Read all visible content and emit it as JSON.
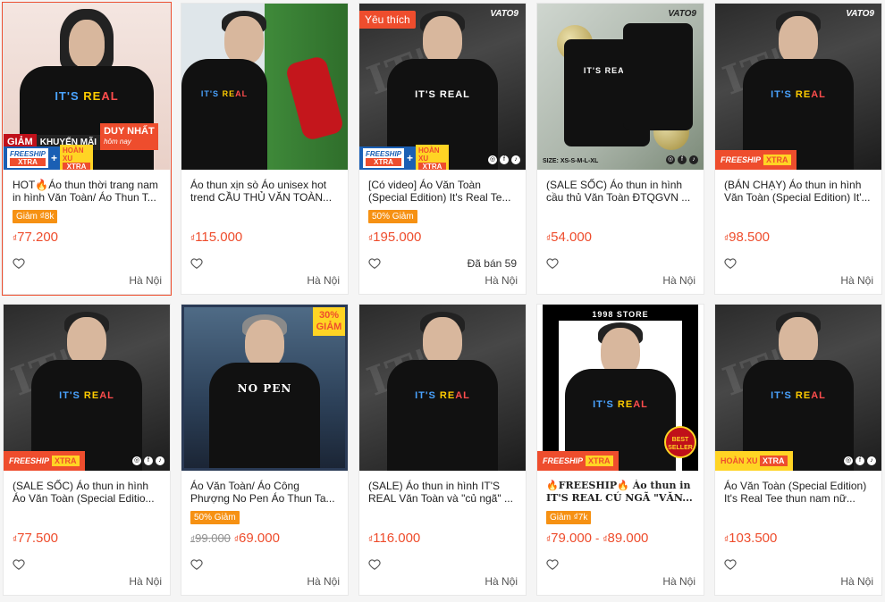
{
  "currency": "₫",
  "products": [
    {
      "image": {
        "badge": "",
        "brand": "",
        "discount": "",
        "promo": [
          "GIẢM",
          "KHUYẾN MÃI",
          "DUY NHẤT",
          "hôm nay"
        ],
        "mini_freeship": "FREESHIP",
        "mini_hoan": "HOÀN XU",
        "mini_xtra": "XTRA"
      },
      "title": "HOT🔥Áo thun thời trang nam in hình Văn Toàn/ Áo Thun T...",
      "tag": "Giảm ₫8k",
      "price": "77.200",
      "old_price": "",
      "price_max": "",
      "sold": "",
      "location": "Hà Nội"
    },
    {
      "image": {
        "badge": "",
        "brand": ""
      },
      "title": "Áo thun xịn sò Áo unisex hot trend CẦU THỦ VĂN TOÀN...",
      "tag": "",
      "price": "115.000",
      "old_price": "",
      "price_max": "",
      "sold": "",
      "location": "Hà Nội"
    },
    {
      "image": {
        "badge": "Yêu thích",
        "brand": "VATO9",
        "mini_freeship": "FREESHIP",
        "mini_hoan": "HOÀN XU",
        "mini_xtra": "XTRA"
      },
      "title": "[Có video] Áo Văn Toàn (Special Edition) It's Real Te...",
      "tag": "50% Giảm",
      "price": "195.000",
      "old_price": "",
      "price_max": "",
      "sold": "Đã bán 59",
      "location": "Hà Nội"
    },
    {
      "image": {
        "badge": "",
        "brand": "VATO9",
        "size": "SIZE: XS-S-M-L-XL"
      },
      "title": "(SALE SỐC) Áo thun in hình cầu thủ Văn Toàn ĐTQGVN ...",
      "tag": "",
      "price": "54.000",
      "old_price": "",
      "price_max": "",
      "sold": "",
      "location": "Hà Nội"
    },
    {
      "image": {
        "badge": "",
        "brand": "VATO9",
        "strip_freeship": "FREESHIP",
        "strip_xtra": "XTRA"
      },
      "title": "(BÁN CHẠY) Áo thun in hình Văn Toàn (Special Edition) It'...",
      "tag": "",
      "price": "98.500",
      "old_price": "",
      "price_max": "",
      "sold": "",
      "location": "Hà Nội"
    },
    {
      "image": {
        "badge": "",
        "brand": "",
        "strip_freeship": "FREESHIP",
        "strip_xtra": "XTRA"
      },
      "title": "(SALE SỐC) Áo thun in hình Áo Văn Toàn (Special Editio...",
      "tag": "",
      "price": "77.500",
      "old_price": "",
      "price_max": "",
      "sold": "",
      "location": "Hà Nội"
    },
    {
      "image": {
        "badge": "",
        "brand": "",
        "discount_pct": "30%",
        "discount_word": "GIẢM",
        "shirt_text": "NO PEN"
      },
      "title": "Áo Văn Toàn/ Áo Công Phượng No Pen Áo Thun Ta...",
      "tag": "50% Giảm",
      "price": "69.000",
      "old_price": "99.000",
      "price_max": "",
      "sold": "",
      "location": "Hà Nội"
    },
    {
      "image": {
        "badge": "",
        "brand": ""
      },
      "title": "(SALE) Áo thun in hình IT'S REAL Văn Toàn và \"củ ngã\" ...",
      "tag": "",
      "price": "116.000",
      "old_price": "",
      "price_max": "",
      "sold": "",
      "location": "Hà Nội"
    },
    {
      "image": {
        "badge": "",
        "brand": "",
        "store": "1998 STORE",
        "best_seller": "BEST SELLER",
        "strip_freeship": "FREESHIP",
        "strip_xtra": "XTRA"
      },
      "title": "🔥FREESHIP🔥 Áo thun in IT'S REAL CÚ NGÃ \"VĂN...",
      "tag": "Giảm ₫7k",
      "price": "79.000",
      "old_price": "",
      "price_max": "89.000",
      "sold": "",
      "location": "Hà Nội"
    },
    {
      "image": {
        "badge": "",
        "brand": "",
        "strip_hoan": "HOÀN XU",
        "strip_xtra": "XTRA"
      },
      "title": "Áo Văn Toàn (Special Edition) It's Real Tee thun nam nữ...",
      "tag": "",
      "price": "103.500",
      "old_price": "",
      "price_max": "",
      "sold": "",
      "location": "Hà Nội"
    }
  ],
  "shirt_print": {
    "a": "IT'S",
    "b": "RE",
    "c": "AL"
  },
  "colors": {
    "accent": "#ee4d2d",
    "tag": "#f69113",
    "xtra": "#ffd424"
  }
}
